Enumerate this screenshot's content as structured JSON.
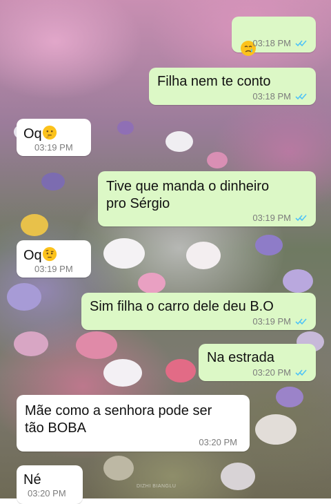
{
  "chat": {
    "messages": [
      {
        "id": "m1",
        "direction": "outgoing",
        "text": "",
        "emoji": "crying-face-emoji",
        "time": "03:18 PM",
        "status": "read"
      },
      {
        "id": "m2",
        "direction": "outgoing",
        "text": "Filha nem te conto",
        "time": "03:18 PM",
        "status": "read"
      },
      {
        "id": "m3",
        "direction": "incoming",
        "text": "Oq",
        "emoji": "thinking-face-emoji",
        "time": "03:19 PM"
      },
      {
        "id": "m4",
        "direction": "outgoing",
        "text": "Tive que manda o dinheiro\npro Sérgio",
        "time": "03:19 PM",
        "status": "read"
      },
      {
        "id": "m5",
        "direction": "incoming",
        "text": "Oq",
        "emoji": "face-with-raised-eyebrow-emoji",
        "time": "03:19 PM"
      },
      {
        "id": "m6",
        "direction": "outgoing",
        "text": "Sim filha o carro dele deu B.O",
        "time": "03:19 PM",
        "status": "read"
      },
      {
        "id": "m7",
        "direction": "outgoing",
        "text": "Na estrada",
        "time": "03:20 PM",
        "status": "read"
      },
      {
        "id": "m8",
        "direction": "incoming",
        "text": "Mãe como a senhora pode ser\ntão BOBA",
        "time": "03:20 PM"
      },
      {
        "id": "m9",
        "direction": "incoming",
        "text": "Né",
        "time": "03:20 PM"
      }
    ]
  },
  "wallpaper": {
    "watermark": "DIZHI BIANGLU"
  },
  "colors": {
    "outgoing_bubble": "#dcf8c6",
    "incoming_bubble": "#ffffff",
    "read_ticks": "#4fc3f7",
    "timestamp": "#7c7c7c"
  }
}
